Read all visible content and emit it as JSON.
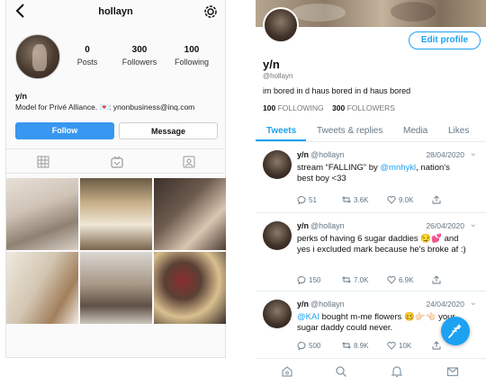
{
  "instagram": {
    "username": "hollayn",
    "stats": [
      {
        "value": "0",
        "label": "Posts"
      },
      {
        "value": "300",
        "label": "Followers"
      },
      {
        "value": "100",
        "label": "Following"
      }
    ],
    "display_name": "y/n",
    "bio_prefix": "Model for Privé Alliance.",
    "bio_heart": "💌",
    "bio_suffix": ": ynonbusiness@inq.com",
    "follow_label": "Follow",
    "message_label": "Message",
    "colors": {
      "follow_button": "#3897f0"
    },
    "grid_icons": [
      "grid-icon",
      "igtv-icon",
      "tagged-icon"
    ]
  },
  "twitter": {
    "edit_profile_label": "Edit profile",
    "name": "y/n",
    "handle": "@hollayn",
    "bio": "im bored in d haus bored in d haus bored",
    "following_count": "100",
    "following_label": "FOLLOWING",
    "followers_count": "300",
    "followers_label": "FOLLOWERS",
    "tabs": [
      "Tweets",
      "Tweets & replies",
      "Media",
      "Likes"
    ],
    "tweets": [
      {
        "name": "y/n",
        "handle": "@hollayn",
        "date": "28/04/2020",
        "text_before": "stream “FALLING” by ",
        "mention": "@mnhykl",
        "text_after": ", nation's best boy <33",
        "replies": "51",
        "retweets": "3.6K",
        "likes": "9.0K"
      },
      {
        "name": "y/n",
        "handle": "@hollayn",
        "date": "26/04/2020",
        "text_before": "perks of having 6 sugar daddies 😏💕 and yes i excluded mark because he's broke af :)",
        "mention": "",
        "text_after": "",
        "replies": "150",
        "retweets": "7.0K",
        "likes": "6.9K"
      },
      {
        "name": "y/n",
        "handle": "@hollayn",
        "date": "24/04/2020",
        "text_before": "",
        "mention": "@KAI",
        "text_after": " bought m-me flowers 🥴👉🏻👈🏻 your sugar daddy could never.",
        "replies": "500",
        "retweets": "8.9K",
        "likes": "10K"
      }
    ],
    "colors": {
      "accent": "#1da1f2"
    },
    "nav_icons": [
      "home-icon",
      "search-icon",
      "notifications-icon",
      "messages-icon"
    ]
  }
}
